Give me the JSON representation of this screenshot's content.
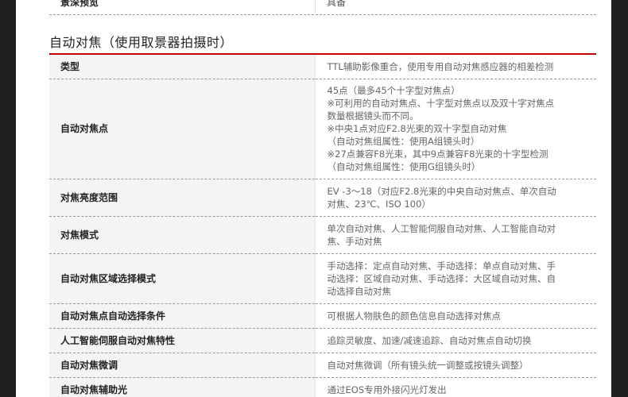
{
  "top_row": {
    "label": "景深预览",
    "value": "具备"
  },
  "section_title": "自动对焦（使用取景器拍摄时）",
  "rows": [
    {
      "label": "类型",
      "lines": [
        "TTL辅助影像重合，使用专用自动对焦感应器的相差检测"
      ]
    },
    {
      "label": "自动对焦点",
      "lines": [
        "45点（最多45个十字型对焦点）",
        "※可利用的自动对焦点、十字型对焦点以及双十字对焦点",
        "数量根据镜头而不同。",
        "※中央1点对应F2.8光束的双十字型自动对焦",
        "（自动对焦组属性：使用A组镜头时）",
        "※27点兼容F8光束，其中9点兼容F8光束的十字型检测",
        "（自动对焦组属性：使用G组镜头时）"
      ]
    },
    {
      "label": "对焦亮度范围",
      "lines": [
        "EV -3～18（对应F2.8光束的中央自动对焦点、单次自动",
        "对焦、23℃、ISO 100）"
      ]
    },
    {
      "label": "对焦模式",
      "lines": [
        "单次自动对焦、人工智能伺服自动对焦、人工智能自动对",
        "焦、手动对焦"
      ]
    },
    {
      "label": "自动对焦区域选择模式",
      "lines": [
        "手动选择：定点自动对焦、手动选择：单点自动对焦、手",
        "动选择：区域自动对焦、手动选择：大区域自动对焦、自",
        "动选择自动对焦"
      ]
    },
    {
      "label": "自动对焦点自动选择条件",
      "lines": [
        "可根据人物肤色的颜色信息自动选择对焦点"
      ]
    },
    {
      "label": "人工智能伺服自动对焦特性",
      "lines": [
        "追踪灵敏度、加速/减速追踪、自动对焦点自动切换"
      ]
    },
    {
      "label": "自动对焦微调",
      "lines": [
        "自动对焦微调（所有镜头统一调整或按镜头调整）"
      ]
    },
    {
      "label": "自动对焦辅助光",
      "lines": [
        "通过EOS专用外接闪光灯发出"
      ]
    }
  ]
}
